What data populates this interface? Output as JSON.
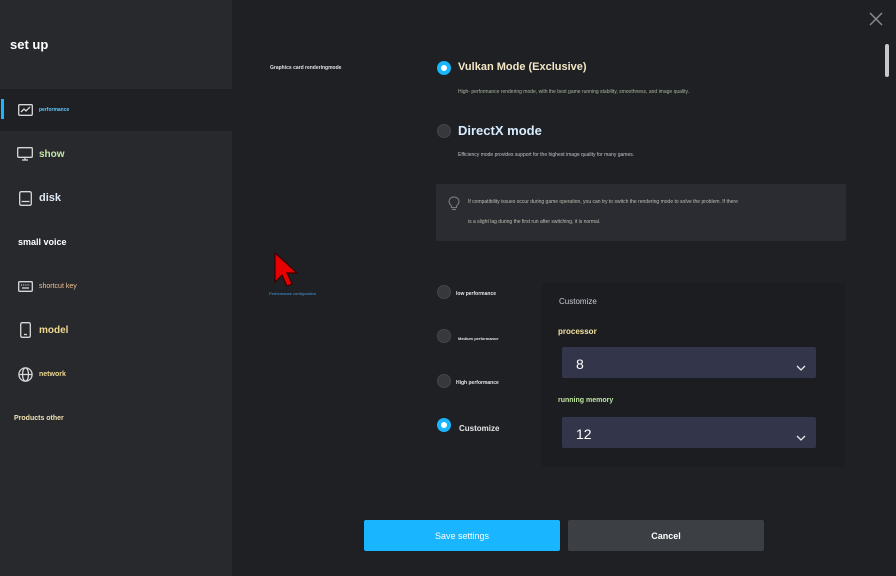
{
  "sidebar": {
    "title": "set up",
    "items": [
      {
        "label": "performance",
        "icon": "chart-line-icon",
        "active": true
      },
      {
        "label": "show",
        "icon": "monitor-icon",
        "active": false
      },
      {
        "label": "disk",
        "icon": "disk-icon",
        "active": false
      },
      {
        "label": "small voice",
        "icon": "",
        "active": false
      },
      {
        "label": "shortcut key",
        "icon": "keyboard-icon",
        "active": false
      },
      {
        "label": "model",
        "icon": "phone-icon",
        "active": false
      },
      {
        "label": "network",
        "icon": "globe-icon",
        "active": false
      },
      {
        "label": "Products other",
        "icon": "",
        "active": false
      }
    ]
  },
  "rendering": {
    "section_label": "Graphics card renderingmode",
    "options": [
      {
        "title": "Vulkan Mode (Exclusive)",
        "selected": true,
        "desc": "High- performance rendering mode, with the best game running stability, smoothness, and image quality."
      },
      {
        "title": "DirectX mode",
        "selected": false,
        "desc": "Efficiency mode provides support for the highest image quality for many games."
      }
    ],
    "tip_line1": "If compatibility issues occur during game operation, you can try to switch the rendering mode to solve the problem. If there",
    "tip_line2": "is a slight lag during the first run after switching, it is normal."
  },
  "performance": {
    "section_label": "Performance configuration",
    "options": [
      {
        "label": "low performance",
        "selected": false
      },
      {
        "label": "Medium performance",
        "selected": false
      },
      {
        "label": "High performance",
        "selected": false
      },
      {
        "label": "Customize",
        "selected": true
      }
    ],
    "custom": {
      "title": "Customize",
      "processor_label": "processor",
      "processor_value": "8",
      "memory_label": "running memory",
      "memory_value": "12"
    }
  },
  "buttons": {
    "save": "Save settings",
    "cancel": "Cancel"
  },
  "colors": {
    "accent": "#19b5fe",
    "sidebar_bg": "#27292d",
    "main_bg": "#1e2024"
  }
}
